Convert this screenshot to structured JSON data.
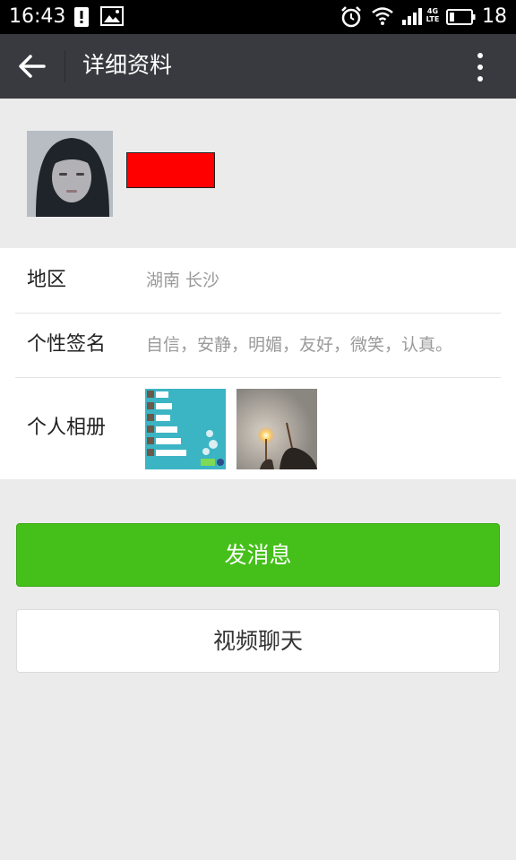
{
  "status_bar": {
    "time": "16:43",
    "battery_level": "18",
    "network_badge": "4G LTE",
    "icons": [
      "alert-icon",
      "image-icon",
      "alarm-icon",
      "wifi-icon",
      "signal-icon",
      "battery-icon"
    ]
  },
  "app_bar": {
    "title": "详细资料",
    "back_icon": "arrow-left-icon",
    "more_icon": "more-vert-icon",
    "background_color": "#393a3f"
  },
  "profile": {
    "avatar": "avatar-photo"
  },
  "details": {
    "region_label": "地区",
    "region_value": "湖南  长沙",
    "signature_label": "个性签名",
    "signature_value": "自信，安静，明媚，友好，微笑，认真。",
    "album_label": "个人相册"
  },
  "actions": {
    "send_message": "发消息",
    "video_chat": "视频聊天",
    "primary_color": "#45c01a"
  }
}
